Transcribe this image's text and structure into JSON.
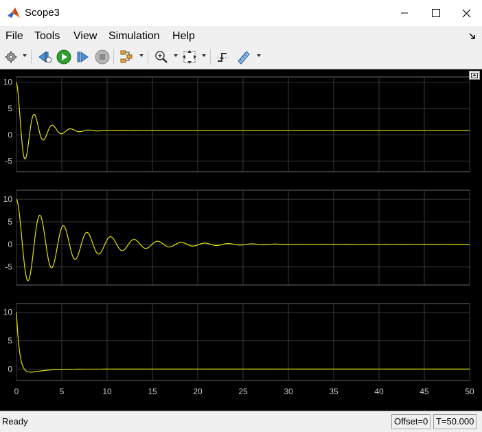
{
  "window": {
    "title": "Scope3",
    "minimize_icon": "minimize-icon",
    "maximize_icon": "maximize-icon",
    "close_icon": "close-icon"
  },
  "menu": {
    "items": [
      {
        "label": "File"
      },
      {
        "label": "Tools"
      },
      {
        "label": "View"
      },
      {
        "label": "Simulation"
      },
      {
        "label": "Help"
      }
    ]
  },
  "toolbar": {
    "buttons": [
      "settings-icon",
      "step-back-icon",
      "run-icon",
      "step-forward-icon",
      "stop-icon",
      "highlight-simulink-block-icon",
      "zoom-icon",
      "scale-axes-icon",
      "triggers-icon",
      "measurements-icon"
    ]
  },
  "colors": {
    "signal": "#e5e500",
    "plot_bg": "#000000",
    "grid": "#3a3a3a",
    "axis_text": "#c8c8c8",
    "play_green": "#2e9e2e"
  },
  "chart_data": [
    {
      "type": "line",
      "xlim": [
        0,
        50
      ],
      "ylim": [
        -7,
        11
      ],
      "yticks": [
        10,
        5,
        0,
        -5
      ],
      "grid": true,
      "series": [
        {
          "signal": "damped_oscillation",
          "initial": 10,
          "final": 0.8,
          "period": 2.0,
          "decay": 0.55,
          "x": [
            0,
            0.5,
            1.0,
            1.5,
            2.0,
            3.0,
            4.0,
            5.0,
            6.0,
            8.0,
            10.0,
            15.0,
            20.0,
            50.0
          ],
          "y": [
            10,
            0,
            -5.2,
            0,
            5.1,
            -2.0,
            2.8,
            -0.3,
            1.7,
            1.2,
            1.0,
            0.85,
            0.8,
            0.8
          ]
        }
      ]
    },
    {
      "type": "line",
      "xlim": [
        0,
        50
      ],
      "ylim": [
        -9,
        12
      ],
      "yticks": [
        10,
        5,
        0,
        -5
      ],
      "grid": true,
      "series": [
        {
          "signal": "damped_oscillation",
          "initial": 10,
          "final": 0.0,
          "period": 2.6,
          "decay": 0.17,
          "x": [
            0,
            0.6,
            1.1,
            1.9,
            2.4,
            3.2,
            3.9,
            4.5,
            5.1,
            6.0,
            10.0,
            20.0,
            35.0,
            50.0
          ],
          "y": [
            10,
            0,
            -7.2,
            0,
            6.8,
            0,
            -5.3,
            0,
            4.9,
            3.3,
            1.5,
            0.4,
            0.05,
            0
          ]
        }
      ]
    },
    {
      "type": "line",
      "xlim": [
        0,
        50
      ],
      "ylim": [
        -2,
        11.5
      ],
      "yticks": [
        10,
        5,
        0
      ],
      "xticks": [
        0,
        5,
        10,
        15,
        20,
        25,
        30,
        35,
        40,
        45,
        50
      ],
      "grid": true,
      "series": [
        {
          "signal": "overdamped_response",
          "initial": 10,
          "final": 0.0,
          "undershoot": -0.8,
          "x": [
            0,
            0.3,
            0.6,
            1.0,
            1.5,
            2.5,
            3.5,
            5.0,
            7.0,
            50.0
          ],
          "y": [
            10,
            5,
            1.2,
            -0.6,
            -0.8,
            -0.1,
            0.3,
            0.2,
            0.05,
            0
          ]
        }
      ]
    }
  ],
  "status": {
    "text": "Ready",
    "offset": "Offset=0",
    "time": "T=50.000"
  }
}
